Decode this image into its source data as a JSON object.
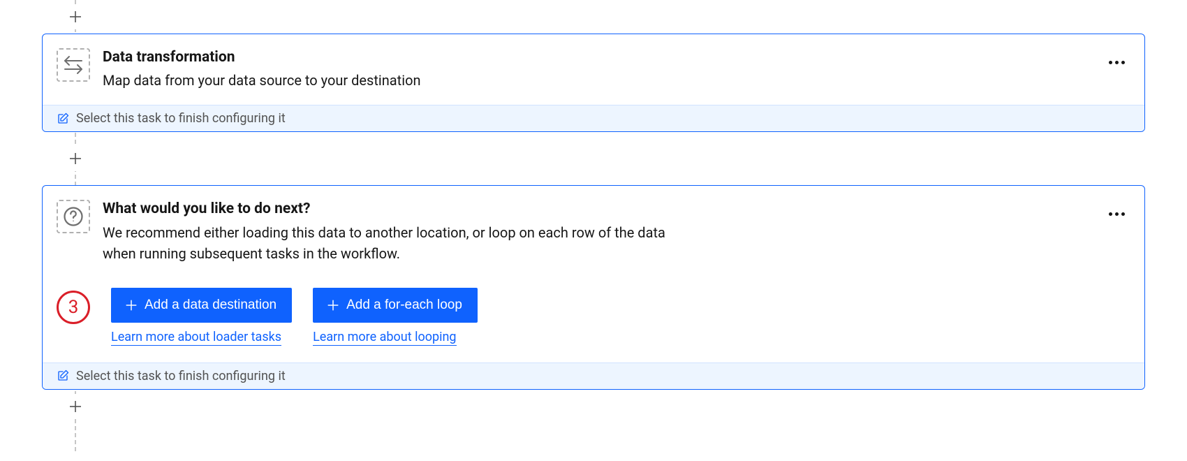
{
  "cards": [
    {
      "title": "Data transformation",
      "desc": "Map data from your data source to your destination",
      "footer": "Select this task to finish configuring it"
    },
    {
      "title": "What would you like to do next?",
      "desc": "We recommend either loading this data to another location, or loop on each row of the data when running subsequent tasks in the workflow.",
      "footer": "Select this task to finish configuring it",
      "stepNumber": "3",
      "actions": [
        {
          "button": "Add a data destination",
          "link": "Learn more about loader tasks"
        },
        {
          "button": "Add a for-each loop",
          "link": "Learn more about looping"
        }
      ]
    }
  ]
}
